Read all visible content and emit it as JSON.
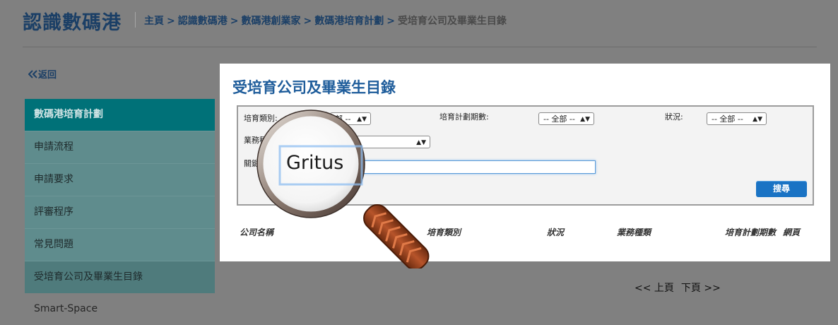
{
  "header": {
    "site_title": "認識數碼港",
    "breadcrumb": [
      "主頁",
      "認識數碼港",
      "數碼港創業家",
      "數碼港培育計劃",
      "受培育公司及畢業生目錄"
    ],
    "separator": ">"
  },
  "back_label": "返回",
  "sidebar": {
    "heading": "數碼港培育計劃",
    "items": [
      {
        "label": "申請流程"
      },
      {
        "label": "申請要求"
      },
      {
        "label": "評審程序"
      },
      {
        "label": "常見問題"
      },
      {
        "label": "受培育公司及畢業生目錄",
        "active": true
      },
      {
        "label": "Smart-Space"
      }
    ]
  },
  "panel": {
    "title": "受培育公司及畢業生目錄",
    "filters": {
      "category_label": "培育類別:",
      "category_value": "部 --",
      "period_label": "培育計劃期數:",
      "period_value": "-- 全部 --",
      "status_label": "狀況:",
      "status_value": "-- 全部 --",
      "business_label": "業務種",
      "keyword_label": "關鍵"
    },
    "search_button": "搜尋",
    "columns": [
      "公司名稱",
      "培育類別",
      "狀況",
      "業務種類",
      "培育計劃期數",
      "網頁"
    ]
  },
  "pager": {
    "prev": "<< 上頁",
    "next": "下頁 >>"
  },
  "magnifier": {
    "text": "Gritus"
  },
  "colors": {
    "overlay": "#808080",
    "brand_navy": "#1b3f66",
    "teal": "#007178",
    "button_blue": "#1a73c4",
    "handle_brown": "#a0441c"
  },
  "icons": [
    "double-chevron-left-icon",
    "magnifier-icon",
    "select-caret-icon"
  ]
}
